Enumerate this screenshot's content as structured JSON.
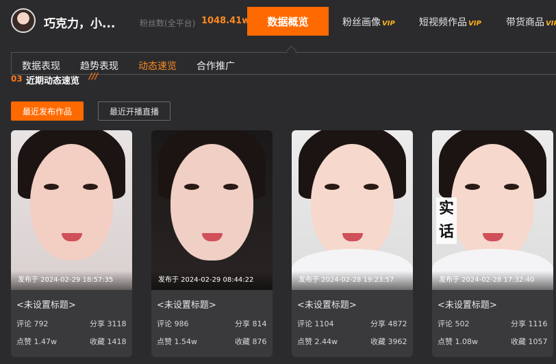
{
  "header": {
    "username": "巧克力，小...",
    "fans_label": "粉丝数(全平台)",
    "fans_value": "1048.41w",
    "nav": [
      {
        "label": "数据概览",
        "vip": ""
      },
      {
        "label": "粉丝画像",
        "vip": "VIP"
      },
      {
        "label": "短视频作品",
        "vip": "VIP"
      },
      {
        "label": "带货商品",
        "vip": "VIP"
      }
    ]
  },
  "subnav": {
    "tabs": [
      "数据表现",
      "趋势表现",
      "动态速览",
      "合作推广"
    ],
    "active_index": 2
  },
  "section": {
    "number": "03",
    "title": "近期动态速览",
    "deco": "///"
  },
  "buttons": {
    "recent_works": "最近发布作品",
    "recent_live": "最近开播直播"
  },
  "cards": [
    {
      "image_text": "",
      "date": "发布于 2024-02-29 18:57:35",
      "title": "<未设置标题>",
      "comment_label": "评论",
      "comment": "792",
      "share_label": "分享",
      "share": "3118",
      "like_label": "点赞",
      "like": "1.47w",
      "fav_label": "收藏",
      "fav": "1418"
    },
    {
      "image_text": "",
      "date": "发布于 2024-02-29 08:44:22",
      "title": "<未设置标题>",
      "comment_label": "评论",
      "comment": "986",
      "share_label": "分享",
      "share": "814",
      "like_label": "点赞",
      "like": "1.54w",
      "fav_label": "收藏",
      "fav": "876"
    },
    {
      "image_text": "",
      "date": "发布于 2024-02-28 19:23:57",
      "title": "<未设置标题>",
      "comment_label": "评论",
      "comment": "1104",
      "share_label": "分享",
      "share": "4872",
      "like_label": "点赞",
      "like": "2.44w",
      "fav_label": "收藏",
      "fav": "3962"
    },
    {
      "image_text": "实话",
      "date": "发布于 2024-02-28 17:32:40",
      "title": "<未设置标题>",
      "comment_label": "评论",
      "comment": "502",
      "share_label": "分享",
      "share": "1116",
      "like_label": "点赞",
      "like": "1.08w",
      "fav_label": "收藏",
      "fav": "1057"
    }
  ],
  "colors": {
    "accent": "#ff6a00",
    "accent_text": "#ff8a1f",
    "bg": "#2b2b2e",
    "card": "#3a3a3d"
  }
}
